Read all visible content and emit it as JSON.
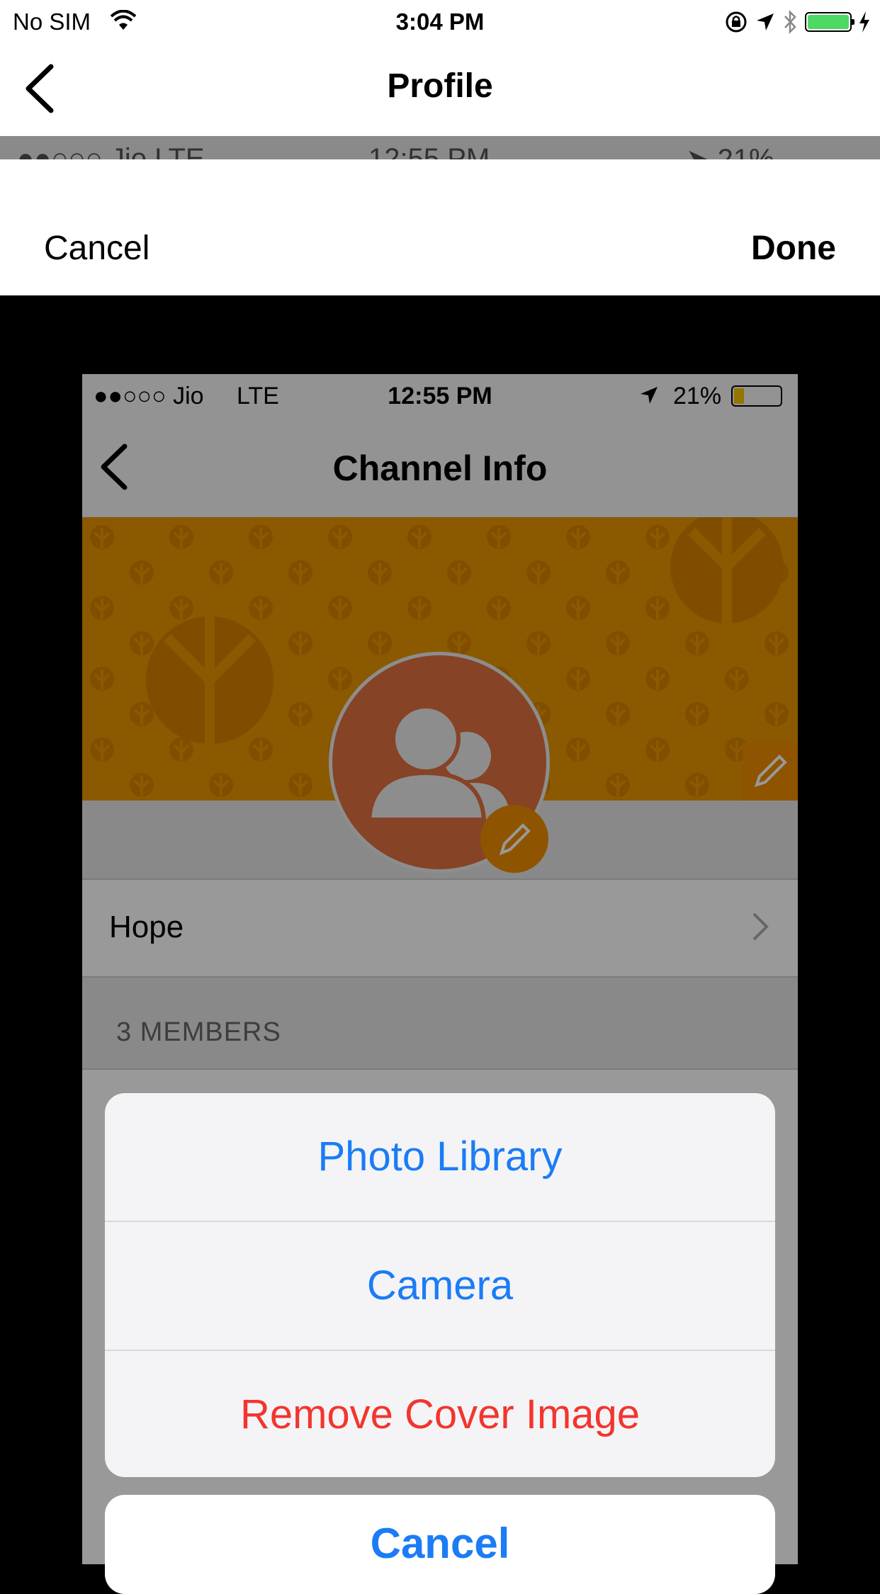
{
  "status_bar": {
    "carrier": "No SIM",
    "time": "3:04 PM"
  },
  "nav": {
    "title": "Profile"
  },
  "editor": {
    "cancel_label": "Cancel",
    "done_label": "Done"
  },
  "preview": {
    "status": {
      "carrier": "●●○○○ Jio",
      "network": "LTE",
      "time": "12:55 PM",
      "battery": "21%"
    },
    "title": "Channel Info",
    "channel_name": "Hope",
    "members_header": "3 MEMBERS"
  },
  "action_sheet": {
    "items": [
      {
        "label": "Photo Library"
      },
      {
        "label": "Camera"
      },
      {
        "label": "Remove Cover Image"
      }
    ],
    "cancel_label": "Cancel"
  },
  "colors": {
    "action_blue": "#1b7cf5",
    "destructive_red": "#f2352e",
    "cover_orange": "#e69500",
    "avatar_orange": "#e07140"
  }
}
